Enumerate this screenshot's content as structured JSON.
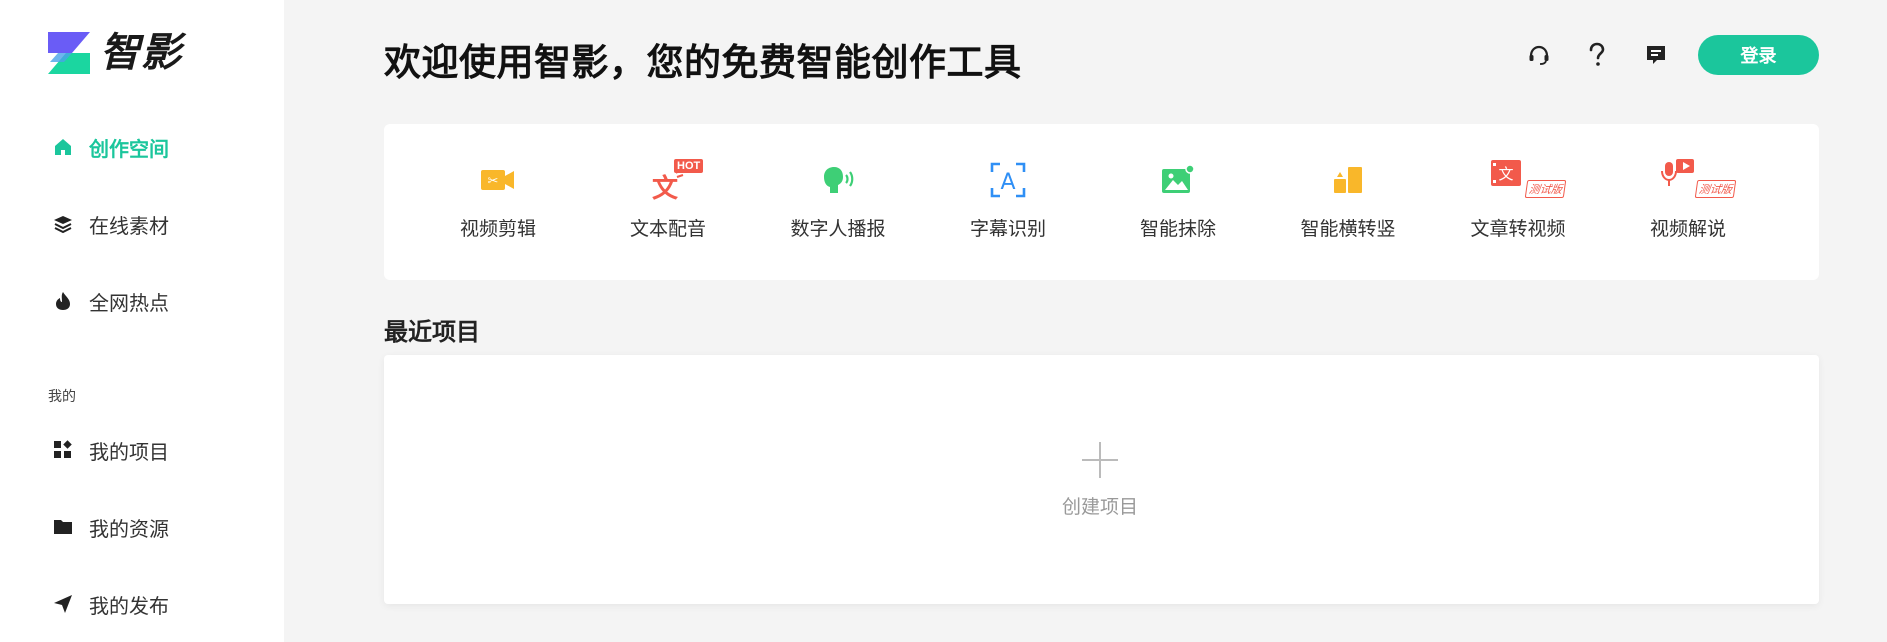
{
  "app": {
    "name": "智影"
  },
  "sidebar": {
    "items": [
      {
        "label": "创作空间",
        "icon": "home-icon",
        "active": true
      },
      {
        "label": "在线素材",
        "icon": "layers-icon"
      },
      {
        "label": "全网热点",
        "icon": "fire-icon"
      }
    ],
    "section_label": "我的",
    "my_items": [
      {
        "label": "我的项目",
        "icon": "grid-icon"
      },
      {
        "label": "我的资源",
        "icon": "folder-icon"
      },
      {
        "label": "我的发布",
        "icon": "send-icon"
      }
    ]
  },
  "header": {
    "title": "欢迎使用智影，您的免费智能创作工具",
    "icons": [
      "headset-icon",
      "help-icon",
      "feedback-icon"
    ],
    "login_label": "登录"
  },
  "tools": [
    {
      "label": "视频剪辑",
      "icon": "video-edit-icon",
      "color": "#f9b72a"
    },
    {
      "label": "文本配音",
      "icon": "text-dub-icon",
      "color": "#f25a4b",
      "badge": "HOT"
    },
    {
      "label": "数字人播报",
      "icon": "digital-human-icon",
      "color": "#3ecf76"
    },
    {
      "label": "字幕识别",
      "icon": "subtitle-icon",
      "color": "#2f8ff5"
    },
    {
      "label": "智能抹除",
      "icon": "erase-icon",
      "color": "#3ecf76"
    },
    {
      "label": "智能横转竖",
      "icon": "rotate-icon",
      "color": "#f9b72a"
    },
    {
      "label": "文章转视频",
      "icon": "article-video-icon",
      "color": "#f25a4b",
      "badge": "测试版"
    },
    {
      "label": "视频解说",
      "icon": "narration-icon",
      "color": "#f25a4b",
      "badge": "测试版"
    }
  ],
  "recent": {
    "title": "最近项目",
    "create_label": "创建项目"
  },
  "colors": {
    "accent": "#1bc69c",
    "background": "#f4f4f4"
  }
}
